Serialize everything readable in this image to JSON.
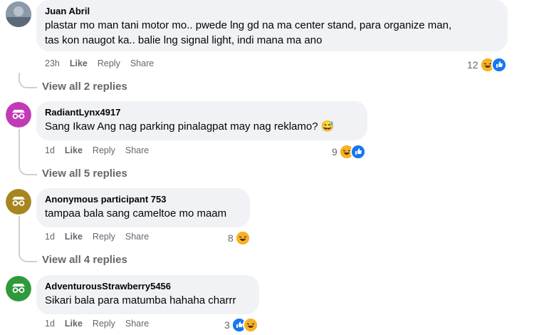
{
  "comments": [
    {
      "author": "Juan Abril",
      "text_lines": [
        "plastar mo man tani motor mo.. pwede lng gd na ma center stand, para organize man,",
        "tas kon naugot ka.. balie lng signal light, indi mana ma ano"
      ],
      "time": "23h",
      "like": "Like",
      "reply": "Reply",
      "share": "Share",
      "reaction_count": "12",
      "reactions": [
        "haha",
        "like"
      ],
      "view_replies": "View all 2 replies"
    },
    {
      "author": "RadiantLynx4917",
      "text_lines": [
        "Sang Ikaw Ang nag parking pinalagpat may nag reklamo? 😅"
      ],
      "time": "1d",
      "like": "Like",
      "reply": "Reply",
      "share": "Share",
      "reaction_count": "9",
      "reactions": [
        "haha",
        "like"
      ],
      "view_replies": "View all 5 replies",
      "avatar_color": "#c23ab5"
    },
    {
      "author": "Anonymous participant 753",
      "text_lines": [
        "tampaa bala sang cameltoe mo maam"
      ],
      "time": "1d",
      "like": "Like",
      "reply": "Reply",
      "share": "Share",
      "reaction_count": "8",
      "reactions": [
        "haha"
      ],
      "view_replies": "View all 4 replies",
      "avatar_color": "#a78620"
    },
    {
      "author": "AdventurousStrawberry5456",
      "text_lines": [
        "Sikari bala para matumba hahaha charrr"
      ],
      "time": "1d",
      "like": "Like",
      "reply": "Reply",
      "share": "Share",
      "reaction_count": "3",
      "reactions": [
        "like",
        "haha"
      ],
      "avatar_color": "#2e9a3c"
    }
  ]
}
